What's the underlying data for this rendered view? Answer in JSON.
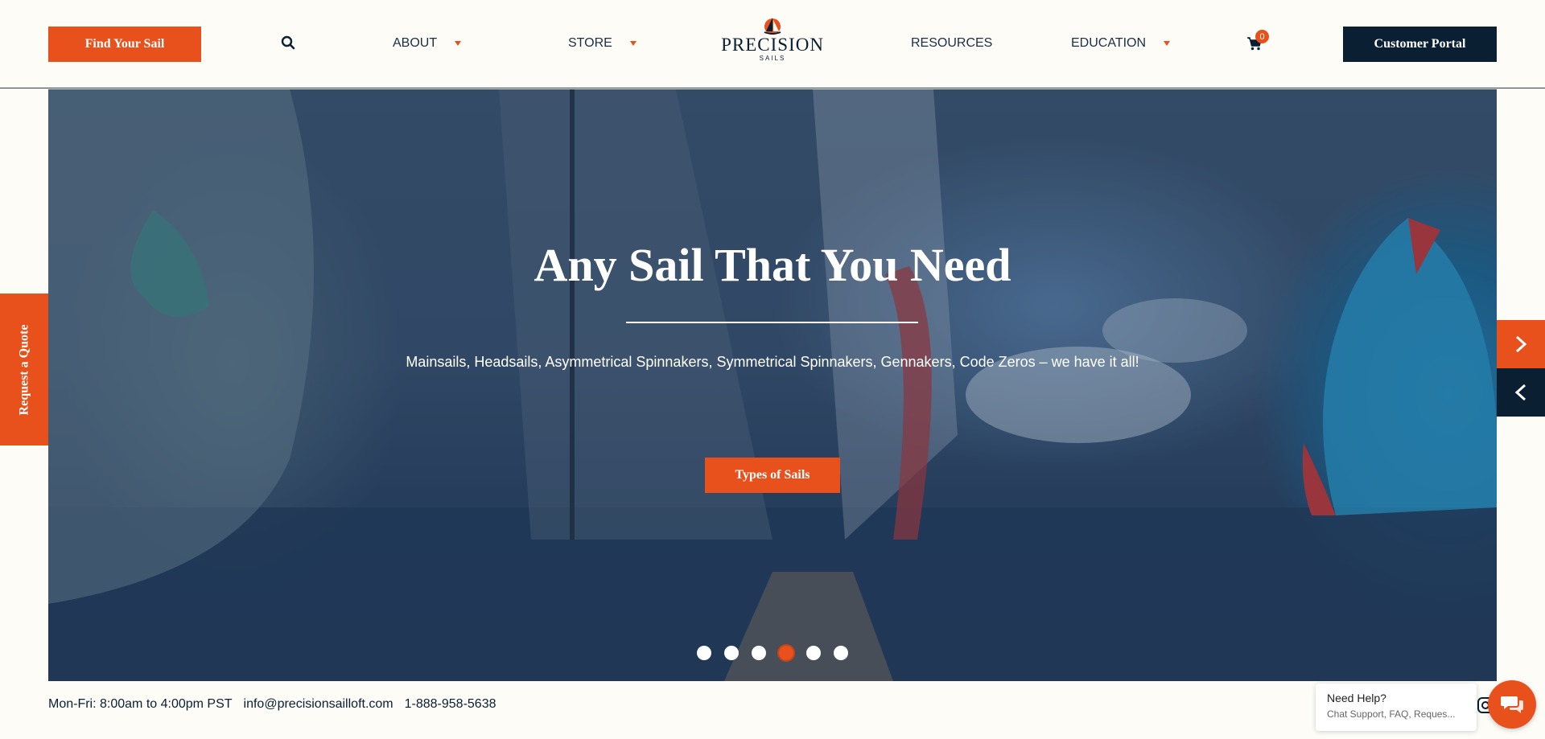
{
  "header": {
    "find_sail_label": "Find Your Sail",
    "nav": [
      {
        "label": "ABOUT",
        "has_dropdown": true
      },
      {
        "label": "STORE",
        "has_dropdown": true
      },
      {
        "label": "RESOURCES",
        "has_dropdown": false
      },
      {
        "label": "EDUCATION",
        "has_dropdown": true
      }
    ],
    "logo": {
      "name": "PRECISION",
      "sub": "SAILS"
    },
    "cart_count": "0",
    "portal_label": "Customer Portal"
  },
  "hero": {
    "title": "Any Sail That You Need",
    "subtitle": "Mainsails, Headsails, Asymmetrical Spinnakers, Symmetrical Spinnakers, Gennakers, Code Zeros – we have it all!",
    "cta_label": "Types of Sails",
    "slide_count": 6,
    "active_slide": 4
  },
  "side": {
    "quote_label": "Request a Quote"
  },
  "contact": {
    "hours": "Mon-Fri: 8:00am to 4:00pm PST",
    "email": "info@precisionsailloft.com",
    "phone": "1-888-958-5638"
  },
  "chat": {
    "title": "Need Help?",
    "subtitle": "Chat Support, FAQ, Reques..."
  },
  "colors": {
    "accent": "#e8501c",
    "navy": "#0b1f33",
    "background": "#fdfcf7"
  },
  "icons": [
    "search-icon",
    "caret-down-icon",
    "cart-icon",
    "chevron-right-icon",
    "chevron-left-icon",
    "chat-icon",
    "instagram-icon"
  ]
}
